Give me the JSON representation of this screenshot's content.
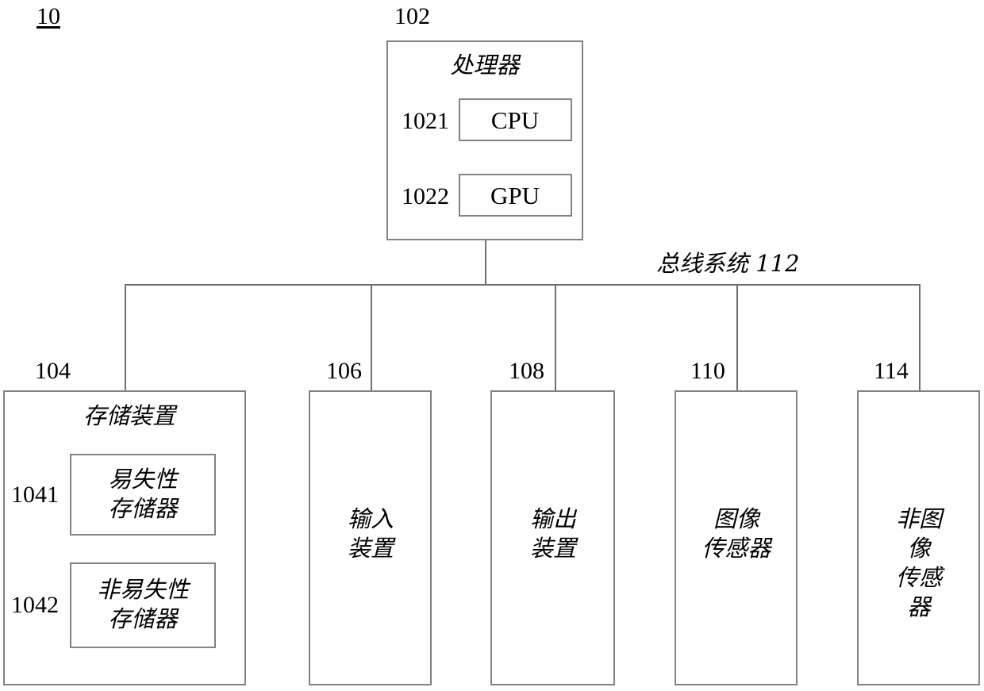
{
  "figure": {
    "id_label": "10",
    "bus_label": "总线系统 112"
  },
  "processor": {
    "ref": "102",
    "title": "处理器",
    "units": [
      {
        "ref": "1021",
        "label": "CPU"
      },
      {
        "ref": "1022",
        "label": "GPU"
      }
    ]
  },
  "storage": {
    "ref": "104",
    "title": "存储装置",
    "memories": [
      {
        "ref": "1041",
        "label": "易失性\n存储器"
      },
      {
        "ref": "1042",
        "label": "非易失性\n存储器"
      }
    ]
  },
  "peripherals": [
    {
      "ref": "106",
      "label": "输入\n装置"
    },
    {
      "ref": "108",
      "label": "输出\n装置"
    },
    {
      "ref": "110",
      "label": "图像\n传感器"
    },
    {
      "ref": "114",
      "label": "非图像\n传感器"
    }
  ],
  "colors": {
    "line": "#6e6e6e",
    "box_border": "#828282",
    "text": "#000000",
    "background": "#ffffff"
  }
}
